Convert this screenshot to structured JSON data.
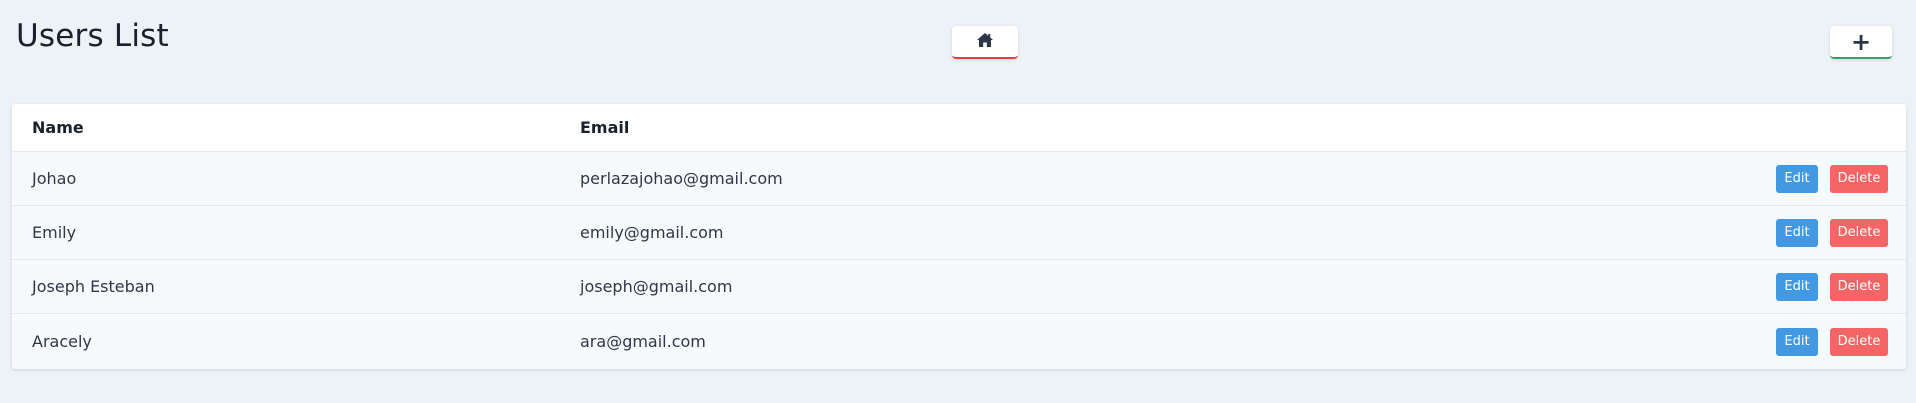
{
  "header": {
    "title": "Users List",
    "home_icon": "home-icon",
    "add_icon": "plus-icon",
    "add_label": "+"
  },
  "colors": {
    "background": "#edf2f7",
    "home_underline": "#e53e3e",
    "add_underline": "#38a169",
    "edit_button": "#4299e1",
    "delete_button": "#f56565"
  },
  "table": {
    "columns": [
      "Name",
      "Email"
    ],
    "rows": [
      {
        "name": "Johao",
        "email": "perlazajohao@gmail.com",
        "edit_label": "Edit",
        "delete_label": "Delete"
      },
      {
        "name": "Emily",
        "email": "emily@gmail.com",
        "edit_label": "Edit",
        "delete_label": "Delete"
      },
      {
        "name": "Joseph Esteban",
        "email": "joseph@gmail.com",
        "edit_label": "Edit",
        "delete_label": "Delete"
      },
      {
        "name": "Aracely",
        "email": "ara@gmail.com",
        "edit_label": "Edit",
        "delete_label": "Delete"
      }
    ]
  }
}
